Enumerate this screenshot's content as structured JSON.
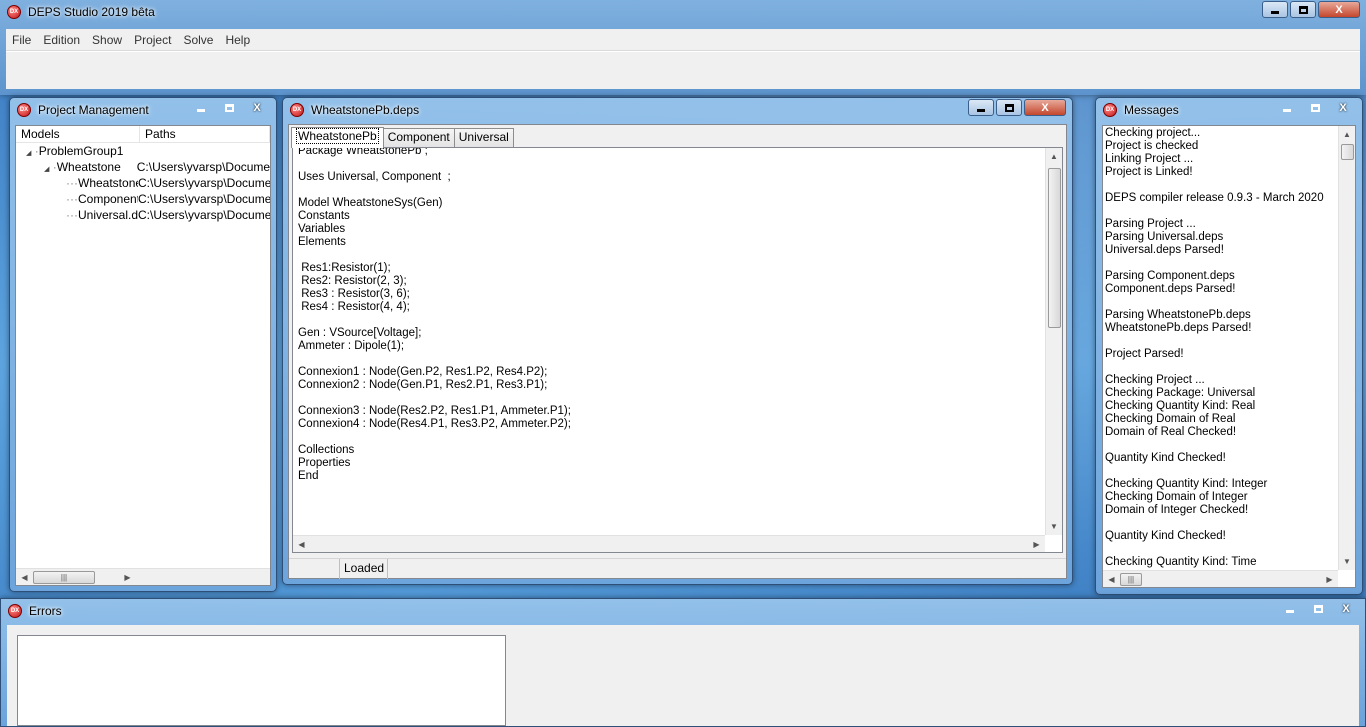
{
  "main": {
    "title": "DEPS Studio 2019 bêta",
    "menu": [
      "File",
      "Edition",
      "Show",
      "Project",
      "Solve",
      "Help"
    ]
  },
  "project_panel": {
    "title": "Project Management",
    "columns": [
      "Models",
      "Paths"
    ],
    "tree": [
      {
        "expander": "◢",
        "name": "ProblemGroup1",
        "path": ""
      },
      {
        "expander": "◢",
        "name": "Wheatstone",
        "path": "C:\\Users\\yvarsp\\Documents"
      },
      {
        "expander": "",
        "name": "WheatstoneP",
        "path": "C:\\Users\\yvarsp\\Documents"
      },
      {
        "expander": "",
        "name": "Component.",
        "path": "C:\\Users\\yvarsp\\Documents"
      },
      {
        "expander": "",
        "name": "Universal.de",
        "path": "C:\\Users\\yvarsp\\Documents"
      }
    ],
    "scroll_thumb": "|||"
  },
  "editor": {
    "title": "WheatstonePb.deps",
    "tabs": [
      "WheatstonePb",
      "Component",
      "Universal"
    ],
    "code": "Package WheatstonePb ;\n\nUses Universal, Component  ;\n\nModel WheatstoneSys(Gen)\nConstants\nVariables\nElements\n\n Res1:Resistor(1);\n Res2: Resistor(2, 3);\n Res3 : Resistor(3, 6);\n Res4 : Resistor(4, 4);\n\nGen : VSource[Voltage];\nAmmeter : Dipole(1);\n\nConnexion1 : Node(Gen.P2, Res1.P2, Res4.P2);\nConnexion2 : Node(Gen.P1, Res2.P1, Res3.P1);\n\nConnexion3 : Node(Res2.P2, Res1.P1, Ammeter.P1);\nConnexion4 : Node(Res4.P1, Res3.P2, Ammeter.P2);\n\nCollections\nProperties\nEnd",
    "status": [
      "",
      "Loaded",
      ""
    ]
  },
  "messages": {
    "title": "Messages",
    "text": "Checking project...\nProject is checked\nLinking Project ...\nProject is Linked!\n\nDEPS compiler release 0.9.3 - March 2020\n\nParsing Project ...\nParsing Universal.deps\nUniversal.deps Parsed!\n\nParsing Component.deps\nComponent.deps Parsed!\n\nParsing WheatstonePb.deps\nWheatstonePb.deps Parsed!\n\nProject Parsed!\n\nChecking Project ...\nChecking Package: Universal\nChecking Quantity Kind: Real\nChecking Domain of Real\nDomain of Real Checked!\n\nQuantity Kind Checked!\n\nChecking Quantity Kind: Integer\nChecking Domain of Integer\nDomain of Integer Checked!\n\nQuantity Kind Checked!\n\nChecking Quantity Kind: Time\nChecking Domain of Time"
  },
  "errors": {
    "title": "Errors"
  },
  "caption": {
    "close": "X"
  },
  "icons": {
    "app": "deps-app-icon",
    "app_label": "DX"
  }
}
